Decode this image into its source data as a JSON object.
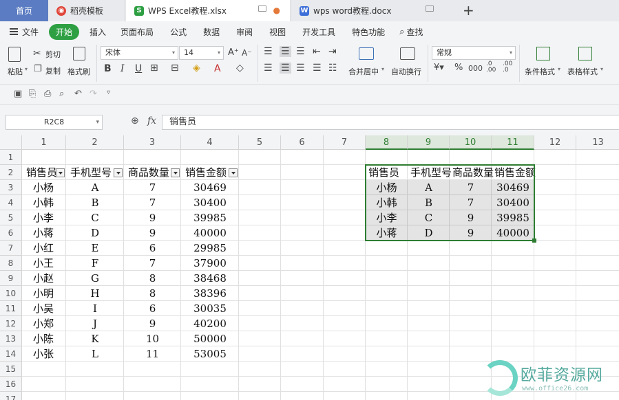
{
  "tabs": {
    "home": "首页",
    "daoke": "稻壳模板",
    "excel": "WPS Excel教程.xlsx",
    "word": "wps word教程.docx",
    "add": "+"
  },
  "menu": {
    "file": "文件",
    "start": "开始",
    "insert": "插入",
    "layout": "页面布局",
    "formula": "公式",
    "data": "数据",
    "review": "审阅",
    "view": "视图",
    "dev": "开发工具",
    "special": "特色功能",
    "search": "查找"
  },
  "ribbon": {
    "paste": "粘贴",
    "cut": "剪切",
    "copy": "复制",
    "format_painter": "格式刷",
    "font_name": "宋体",
    "font_size": "14",
    "merge_center": "合并居中",
    "wrap_text": "自动换行",
    "number_format": "常规",
    "conditional_format": "条件格式",
    "table_style": "表格样式"
  },
  "formula_bar": {
    "name_box": "R2C8",
    "fx": "fx",
    "value": "销售员"
  },
  "sheet": {
    "col_headers": [
      "1",
      "2",
      "3",
      "4",
      "5",
      "6",
      "7",
      "8",
      "9",
      "10",
      "11",
      "12",
      "13"
    ],
    "row_headers": [
      "1",
      "2",
      "3",
      "4",
      "5",
      "6",
      "7",
      "8",
      "9",
      "10",
      "11",
      "12",
      "13",
      "14",
      "15",
      "16",
      "17"
    ],
    "table_left": {
      "headers": [
        "销售员",
        "手机型号",
        "商品数量",
        "销售金额"
      ],
      "rows": [
        [
          "小杨",
          "A",
          "7",
          "30469"
        ],
        [
          "小韩",
          "B",
          "7",
          "30400"
        ],
        [
          "小李",
          "C",
          "9",
          "39985"
        ],
        [
          "小蒋",
          "D",
          "9",
          "40000"
        ],
        [
          "小红",
          "E",
          "6",
          "29985"
        ],
        [
          "小王",
          "F",
          "7",
          "37900"
        ],
        [
          "小赵",
          "G",
          "8",
          "38468"
        ],
        [
          "小明",
          "H",
          "8",
          "38396"
        ],
        [
          "小吴",
          "I",
          "6",
          "30035"
        ],
        [
          "小郑",
          "J",
          "9",
          "40200"
        ],
        [
          "小陈",
          "K",
          "10",
          "50000"
        ],
        [
          "小张",
          "L",
          "11",
          "53005"
        ]
      ]
    },
    "table_right": {
      "headers": [
        "销售员",
        "手机型号",
        "商品数量",
        "销售金额"
      ],
      "rows": [
        [
          "小杨",
          "A",
          "7",
          "30469"
        ],
        [
          "小韩",
          "B",
          "7",
          "30400"
        ],
        [
          "小李",
          "C",
          "9",
          "39985"
        ],
        [
          "小蒋",
          "D",
          "9",
          "40000"
        ]
      ]
    }
  },
  "watermark": {
    "text": "欧菲资源网",
    "url": "www.office26.com"
  },
  "colors": {
    "accent_green": "#2ea043",
    "selection_green": "#2e7d32",
    "home_tab": "#5b7cc2"
  }
}
